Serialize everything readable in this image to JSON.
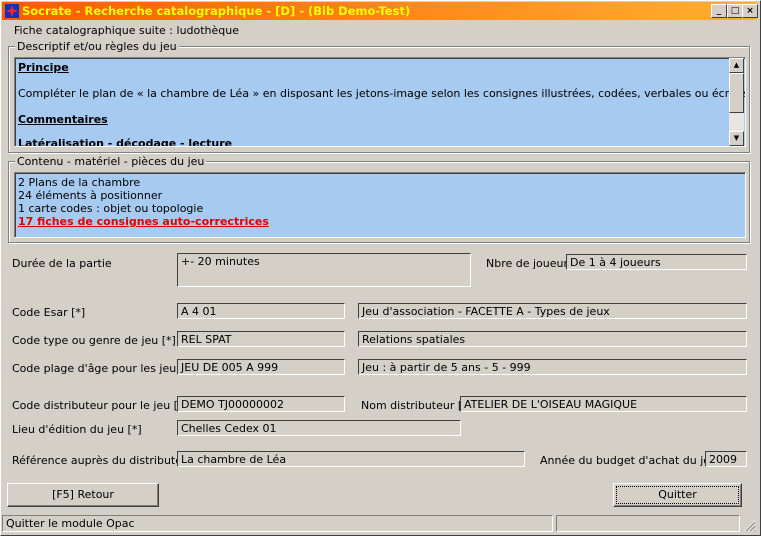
{
  "window": {
    "title": "Socrate - Recherche catalographique - [D] - (Bib Demo-Test)",
    "minimize_glyph": "_",
    "maximize_glyph": "□",
    "close_glyph": "×"
  },
  "form": {
    "heading": "Fiche catalographique suite : ludothèque"
  },
  "descriptif": {
    "label": "Descriptif et/ou règles du jeu",
    "principe_heading": "Principe",
    "principe_text": "Compléter le plan de « la chambre de Léa » en disposant les jetons-image selon les consignes illustrées, codées, verbales ou écrites.",
    "commentaires_heading": "Commentaires",
    "partial_text": "Latéralisation - décodage - lecture"
  },
  "contenu": {
    "label": "Contenu - matériel - pièces du jeu",
    "lines": [
      "2 Plans de la chambre",
      "24 éléments à positionner",
      "1 carte codes : objet ou topologie"
    ],
    "highlight": "17 fiches de consignes auto-correctrices"
  },
  "fields": {
    "duree_label": "Durée de la partie",
    "duree_value": "+- 20 minutes",
    "joueurs_label": "Nbre de joueurs",
    "joueurs_value": "De 1 à 4 joueurs",
    "esar_label": "Code Esar [*]",
    "esar_value": "A 4 01",
    "esar_desc": "Jeu d'association - FACETTE A - Types de jeux",
    "type_label": "Code type ou genre de jeu [*]",
    "type_value": "REL SPAT",
    "type_desc": "Relations spatiales",
    "age_label": "Code plage d'âge pour les jeux [*]",
    "age_value": "JEU DE 005 A 999",
    "age_desc": "Jeu : à partir de 5 ans - 5 - 999",
    "distrib_label": "Code distributeur pour le jeu [*]",
    "distrib_value": "DEMO TJ00000002",
    "nom_distrib_label": "Nom distributeur [*]",
    "nom_distrib_value": "ATELIER DE L'OISEAU MAGIQUE",
    "lieu_label": "Lieu d'édition du jeu [*]",
    "lieu_value": "Chelles Cedex 01",
    "ref_label": "Référence auprès du distributeur",
    "ref_value": "La chambre de Léa",
    "annee_label": "Année du budget d'achat du jeu",
    "annee_value": "2009"
  },
  "buttons": {
    "retour": "[F5] Retour",
    "quitter": "Quitter"
  },
  "statusbar": {
    "text": "Quitter le module Opac"
  }
}
